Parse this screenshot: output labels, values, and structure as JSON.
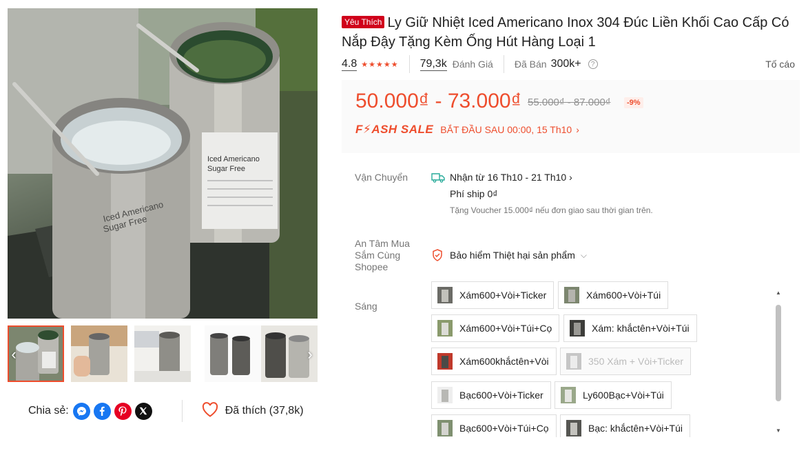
{
  "product": {
    "badge": "Yêu Thích",
    "title": "Ly Giữ Nhiệt Iced Americano Inox 304 Đúc Liền Khối Cao Cấp Có Nắp Đậy Tặng Kèm Ống Hút Hàng Loại 1"
  },
  "gallery": {
    "main_image_label": "stainless-steel-tumblers-photo",
    "cup_label_1": "Iced Americano",
    "cup_label_2": "Sugar Free",
    "thumbnails": [
      "thumb-1",
      "thumb-2",
      "thumb-3",
      "thumb-4",
      "thumb-5"
    ],
    "prev_icon": "chevron-left-icon",
    "next_icon": "chevron-right-icon"
  },
  "share": {
    "label": "Chia sẻ:",
    "networks": [
      "messenger",
      "facebook",
      "pinterest",
      "x"
    ],
    "like_label": "Đã thích (37,8k)"
  },
  "rating": {
    "score": "4.8",
    "stars": "★★★★★",
    "review_count": "79,3k",
    "review_label": "Đánh Giá",
    "sold_label": "Đã Bán",
    "sold_count": "300k+",
    "report": "Tố cáo"
  },
  "price": {
    "range": "50.000₫ - 73.000₫",
    "original": "55.000₫ - 87.000₫",
    "discount": "-9%",
    "flash_logo": "F⚡ASH SALE",
    "flash_text": "BẮT ĐẦU SAU 00:00, 15 Th10",
    "flash_chevron": "›"
  },
  "shipping": {
    "label": "Vận Chuyển",
    "receive": "Nhận từ 16 Th10 - 21 Th10 ›",
    "fee": "Phí ship 0₫",
    "note": "Tặng Voucher 15.000₫ nếu đơn giao sau thời gian trên."
  },
  "assurance": {
    "label": "An Tâm Mua Sắm Cùng Shopee",
    "value": "Bảo hiểm Thiệt hại sản phẩm",
    "chevron": "⌵"
  },
  "variants": {
    "label": "Sáng",
    "options": [
      {
        "label": "Xám600+Vòi+Ticker",
        "disabled": false
      },
      {
        "label": "Xám600+Vòi+Túi",
        "disabled": false
      },
      {
        "label": "Xám600+Vòi+Túi+Cọ",
        "disabled": false
      },
      {
        "label": "Xám: khắctên+Vòi+Túi",
        "disabled": false
      },
      {
        "label": "Xám600khắctên+Vòi",
        "disabled": false
      },
      {
        "label": "350 Xám + Vòi+Ticker",
        "disabled": true
      },
      {
        "label": "Bạc600+Vòi+Ticker",
        "disabled": false
      },
      {
        "label": "Ly600Bạc+Vòi+Túi",
        "disabled": false
      },
      {
        "label": "Bạc600+Vòi+Túi+Cọ",
        "disabled": false
      },
      {
        "label": "Bạc: khắctên+Vòi+Túi",
        "disabled": false
      }
    ]
  },
  "colors": {
    "accent": "#ee4d2d",
    "favorite": "#d0011b",
    "messenger": "#1877f2",
    "facebook": "#1877f2",
    "pinterest": "#e60023",
    "x": "#111111"
  }
}
